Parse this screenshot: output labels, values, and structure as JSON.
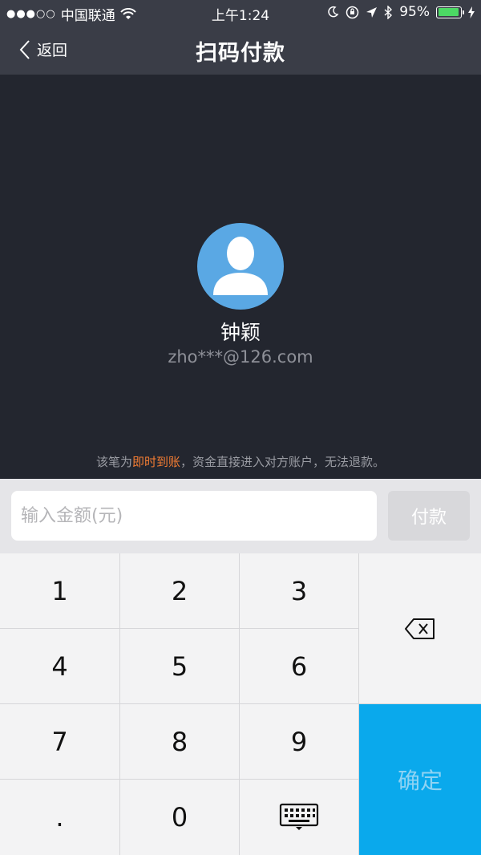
{
  "status_bar": {
    "carrier": "中国联通",
    "signal_dots": "●●●○○",
    "time": "上午1:24",
    "battery_percent": "95%",
    "battery_level": 0.95
  },
  "nav": {
    "back_label": "返回",
    "title": "扫码付款"
  },
  "payee": {
    "name": "钟颖",
    "account": "zho***@126.com"
  },
  "notice": {
    "prefix": "该笔为",
    "highlight": "即时到账",
    "suffix": "，资金直接进入对方账户，无法退款。"
  },
  "amount_input": {
    "placeholder": "输入金额(元)",
    "value": ""
  },
  "pay_button": {
    "label": "付款"
  },
  "keypad": {
    "keys": [
      "1",
      "2",
      "3",
      "4",
      "5",
      "6",
      "7",
      "8",
      "9",
      ".",
      "0"
    ],
    "confirm_label": "确定"
  },
  "colors": {
    "dark_bg": "#23262f",
    "bar_bg": "#3a3d47",
    "accent_orange": "#f27c33",
    "confirm_blue": "#0aa9ec",
    "avatar_blue": "#5aa8e4"
  }
}
